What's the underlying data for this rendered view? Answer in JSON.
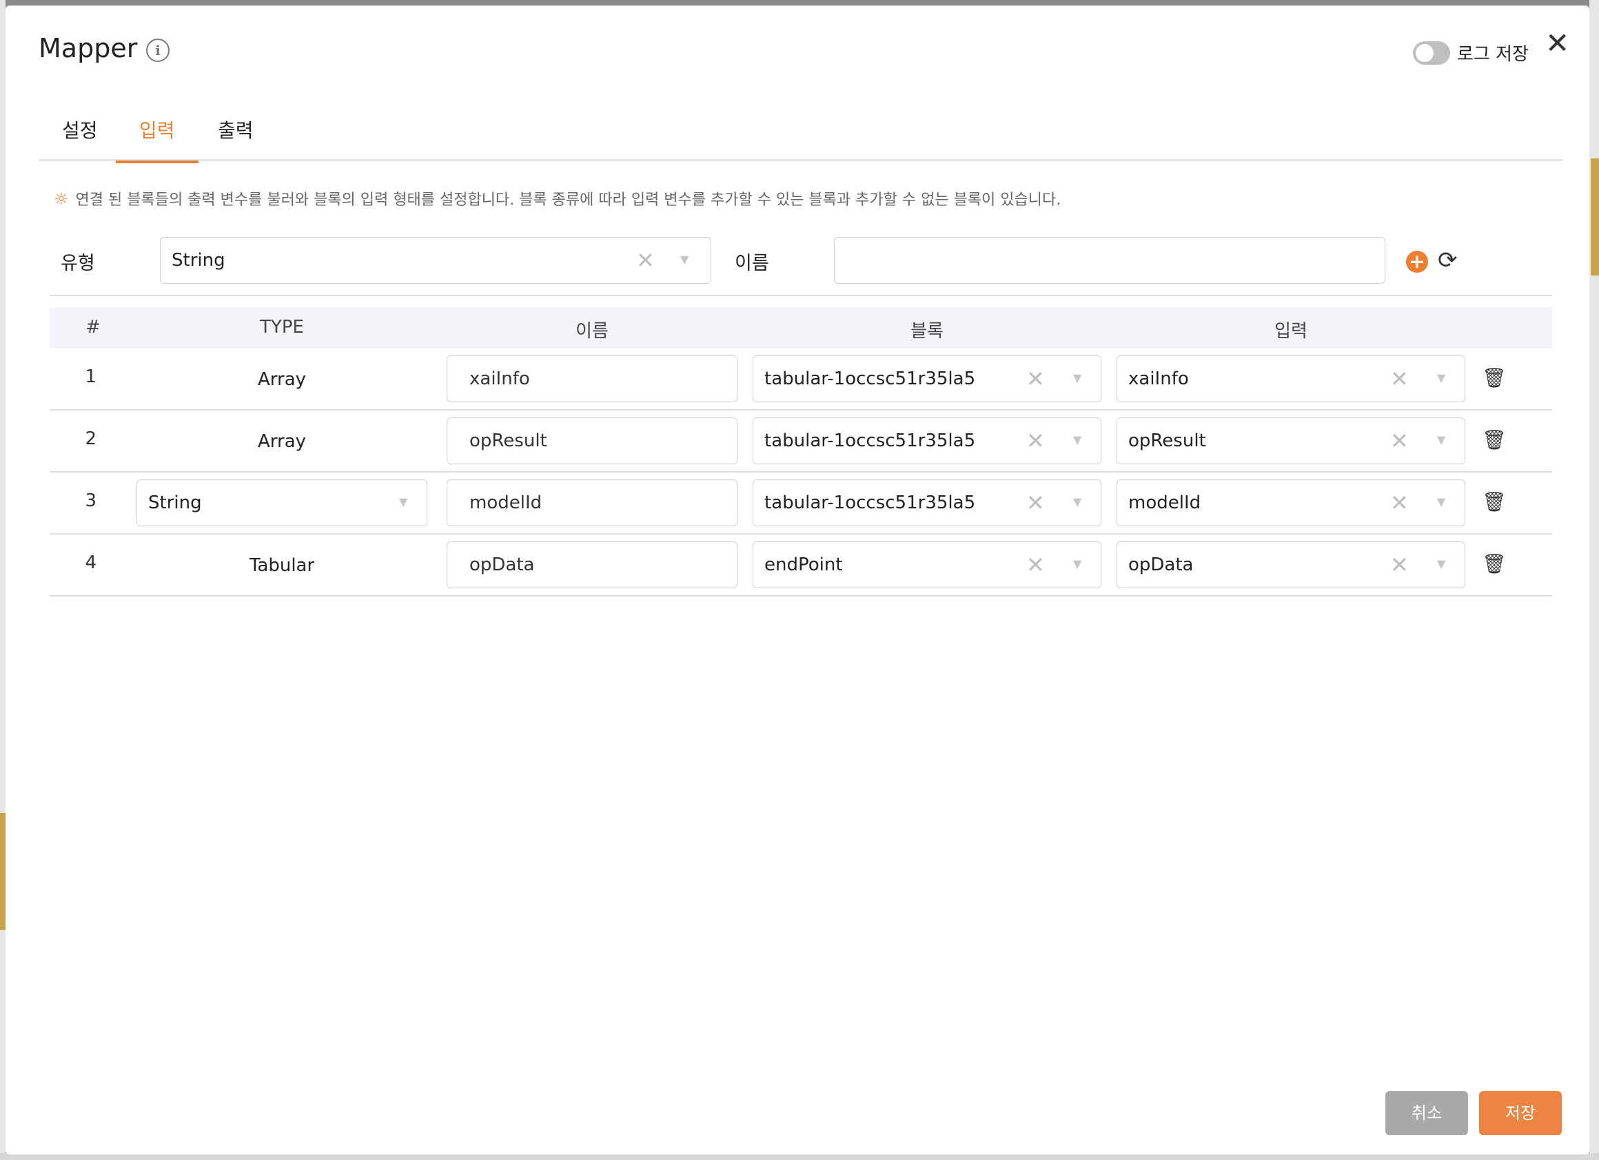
{
  "dialog": {
    "title": "Mapper",
    "log_save_label": "로그 저장",
    "log_save_enabled": false
  },
  "tabs": [
    {
      "label": "설정",
      "active": false
    },
    {
      "label": "입력",
      "active": true
    },
    {
      "label": "출력",
      "active": false
    }
  ],
  "hint": "연결 된 블록들의 출력 변수를 불러와 블록의 입력 형태를 설정합니다. 블록 종류에 따라 입력 변수를 추가할 수 있는 블록과 추가할 수 없는 블록이 있습니다.",
  "form": {
    "type_label": "유형",
    "type_value": "String",
    "name_label": "이름",
    "name_value": ""
  },
  "table": {
    "headers": [
      "#",
      "TYPE",
      "이름",
      "블록",
      "입력"
    ],
    "rows": [
      {
        "num": "1",
        "type": "Array",
        "type_is_select": false,
        "name": "xaiInfo",
        "block": "tabular-1occsc51r35la5",
        "input": "xaiInfo"
      },
      {
        "num": "2",
        "type": "Array",
        "type_is_select": false,
        "name": "opResult",
        "block": "tabular-1occsc51r35la5",
        "input": "opResult"
      },
      {
        "num": "3",
        "type": "String",
        "type_is_select": true,
        "name": "modelId",
        "block": "tabular-1occsc51r35la5",
        "input": "modelId"
      },
      {
        "num": "4",
        "type": "Tabular",
        "type_is_select": false,
        "name": "opData",
        "block": "endPoint",
        "input": "opData"
      }
    ]
  },
  "footer": {
    "cancel_label": "취소",
    "save_label": "저장"
  },
  "colors": {
    "accent": "#ee7f31",
    "save_button": "#ee8442",
    "cancel_button": "#a9a9a9",
    "table_header_bg": "#f2f4fa"
  }
}
